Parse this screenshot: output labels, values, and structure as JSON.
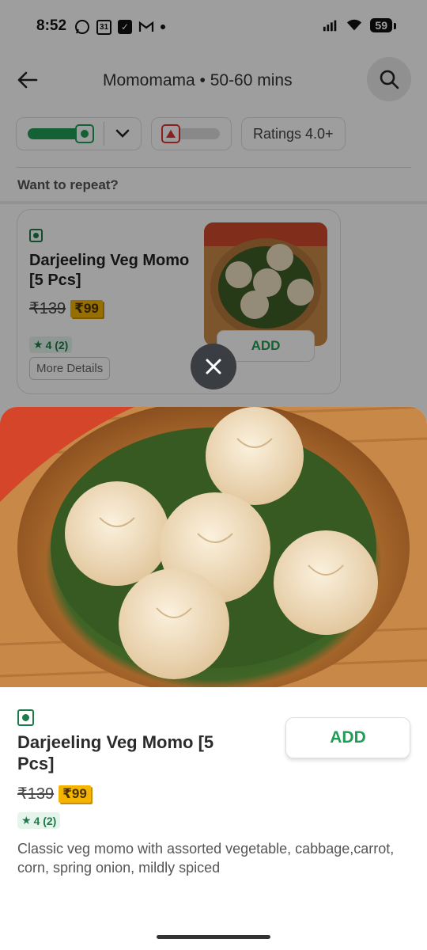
{
  "status_bar": {
    "time": "8:52",
    "calendar_day": "31",
    "battery": "59"
  },
  "header": {
    "title": "Momomama • 50-60 mins"
  },
  "filters": {
    "ratings_label": "Ratings 4.0+"
  },
  "section": {
    "repeat_label": "Want to repeat?"
  },
  "card": {
    "name": "Darjeeling Veg Momo [5 Pcs]",
    "old_price": "₹139",
    "new_price": "₹99",
    "rating": "4 (2)",
    "more_details": "More Details",
    "add_label": "ADD"
  },
  "sheet": {
    "name": "Darjeeling Veg Momo [5 Pcs]",
    "old_price": "₹139",
    "new_price": "₹99",
    "rating": "4 (2)",
    "description": "Classic veg momo with assorted vegetable, cabbage,carrot, corn, spring onion, mildly spiced",
    "add_label": "ADD"
  },
  "colors": {
    "brand_green": "#1f9d55",
    "price_badge": "#f4b400",
    "nonveg_red": "#dd3333"
  }
}
